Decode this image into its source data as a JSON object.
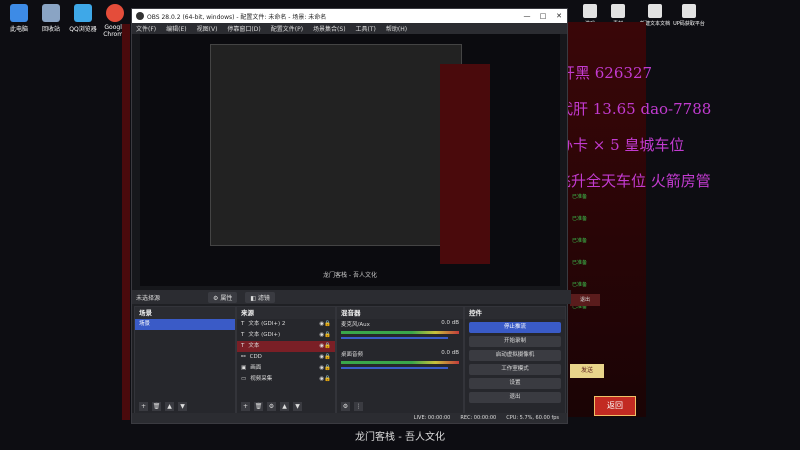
{
  "desktop": {
    "icons": [
      {
        "label": "此电脑",
        "color": "#3d8be6"
      },
      {
        "label": "回收站",
        "color": "#8aa4c4"
      },
      {
        "label": "QQ浏览器",
        "color": "#3ea8e8"
      },
      {
        "label": "Google Chrome",
        "color": "#e44d3a"
      }
    ],
    "right_icons": [
      {
        "label": "游戏"
      },
      {
        "label": "素材"
      },
      {
        "label": "新建文本文档"
      },
      {
        "label": "UP码获取平台"
      }
    ]
  },
  "obs": {
    "title": "OBS 28.0.2 (64-bit, windows) - 配置文件: 未命名 - 场景: 未命名",
    "window_controls": [
      "—",
      "□",
      "✕"
    ],
    "menu": [
      "文件(F)",
      "编辑(E)",
      "视图(V)",
      "停靠窗口(D)",
      "配置文件(P)",
      "场景集合(S)",
      "工具(T)",
      "帮助(H)"
    ],
    "scene_bar": {
      "label": "未选择源",
      "properties": "属性",
      "filters": "滤镜"
    },
    "preview_caption": "龙门客栈 - 吾人文化",
    "scenes": {
      "title": "场景",
      "items": [
        "场景"
      ]
    },
    "sources": {
      "title": "来源",
      "items": [
        {
          "label": "文本 (GDI+) 2",
          "active": false
        },
        {
          "label": "文本 (GDI+)",
          "active": false
        },
        {
          "label": "文本",
          "active": true
        },
        {
          "label": "CDD",
          "active": false
        },
        {
          "label": "画面",
          "active": false
        },
        {
          "label": "视频采集",
          "active": false
        }
      ]
    },
    "mixer": {
      "title": "混音器",
      "channels": [
        {
          "name": "麦克风/Aux",
          "db": "0.0 dB"
        },
        {
          "name": "桌面音频",
          "db": "0.0 dB"
        }
      ]
    },
    "controls": {
      "title": "控件",
      "buttons": [
        "停止推流",
        "开始录制",
        "启动虚拟摄像机",
        "工作室模式",
        "设置",
        "退出"
      ]
    },
    "status": {
      "live": "LIVE: 00:00:00",
      "rec": "REC: 00:00:00",
      "cpu": "CPU: 5.7%, 60.00 fps"
    }
  },
  "overlay": {
    "line1": "开黑 626327",
    "line2": "代肝 13.65 dao-7788",
    "line3": "办卡 × 5 皇城车位",
    "line4": "飞升全天车位 火箭房管"
  },
  "game": {
    "green_labels": [
      "已准备",
      "已准备",
      "已准备",
      "已准备",
      "已准备",
      "已准备"
    ],
    "exit_label": "退出",
    "send_label": "发送",
    "return_label": "返回",
    "bottom_left": "发送",
    "bottom_right": "返回"
  },
  "caption": "龙门客栈 - 吾人文化",
  "colors": {
    "accent": "#3a5bc7",
    "overlay_text": "#c23bd0",
    "active_source": "#7a1f26",
    "ready_green": "#3cbb4a"
  }
}
